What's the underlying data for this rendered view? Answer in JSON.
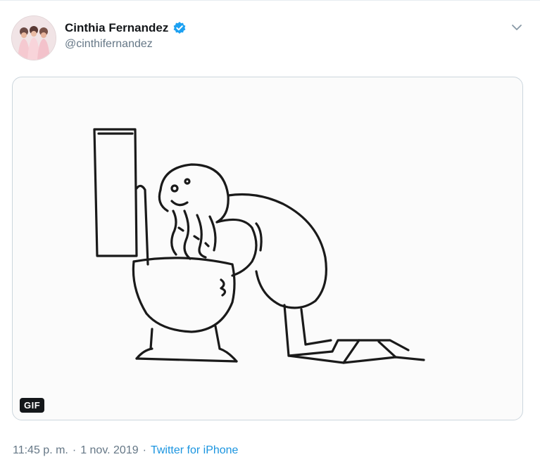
{
  "author": {
    "display_name": "Cinthia Fernandez",
    "handle": "@cinthifernandez",
    "verified": true
  },
  "media": {
    "badge": "GIF"
  },
  "meta": {
    "time": "11:45 p. m.",
    "separator1": "·",
    "date": "1 nov. 2019",
    "separator2": "·",
    "source": "Twitter for iPhone"
  },
  "icons": {
    "verified": "verified-badge-icon",
    "caret": "chevron-down-icon"
  },
  "colors": {
    "verified_blue": "#1da1f2",
    "link_blue": "#1b95e0",
    "muted_text": "#657786"
  }
}
